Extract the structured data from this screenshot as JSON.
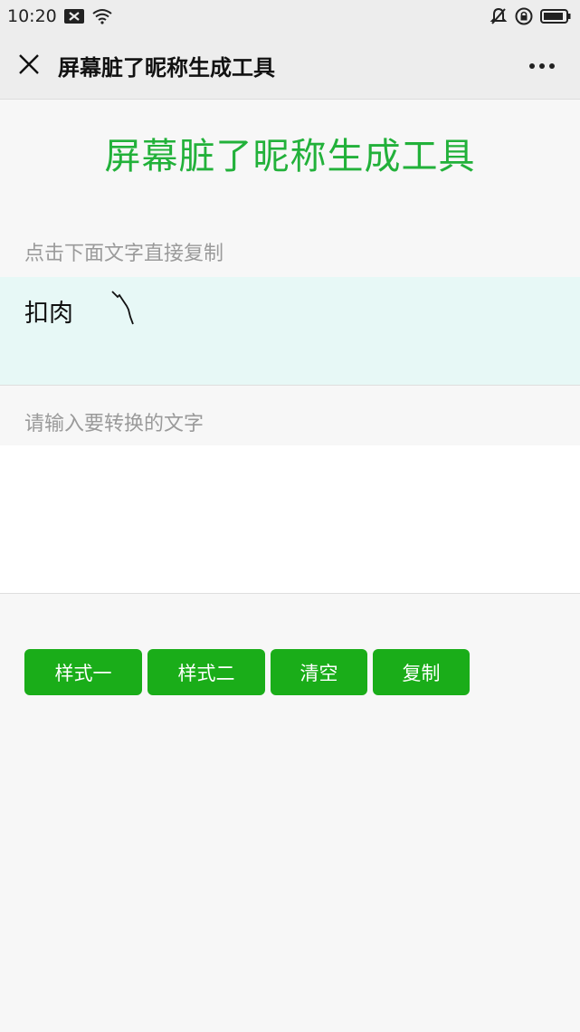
{
  "status_bar": {
    "time": "10:20",
    "icons": [
      "mail-x-icon",
      "wifi-icon",
      "mute-bell-icon",
      "rotation-lock-icon",
      "battery-icon"
    ]
  },
  "title_bar": {
    "title": "屏幕脏了昵称生成工具",
    "close_icon": "close-icon",
    "more_icon": "more-icon"
  },
  "main": {
    "heading": "屏幕脏了昵称生成工具",
    "copy_hint": "点击下面文字直接复制",
    "result_text": "扣肉",
    "input_placeholder": "请输入要转换的文字",
    "input_value": ""
  },
  "buttons": {
    "style1": "样式一",
    "style2": "样式二",
    "clear": "清空",
    "copy": "复制"
  },
  "colors": {
    "accent_green": "#1aad19",
    "heading_green": "#22b13a",
    "result_bg": "#e7f8f6"
  }
}
